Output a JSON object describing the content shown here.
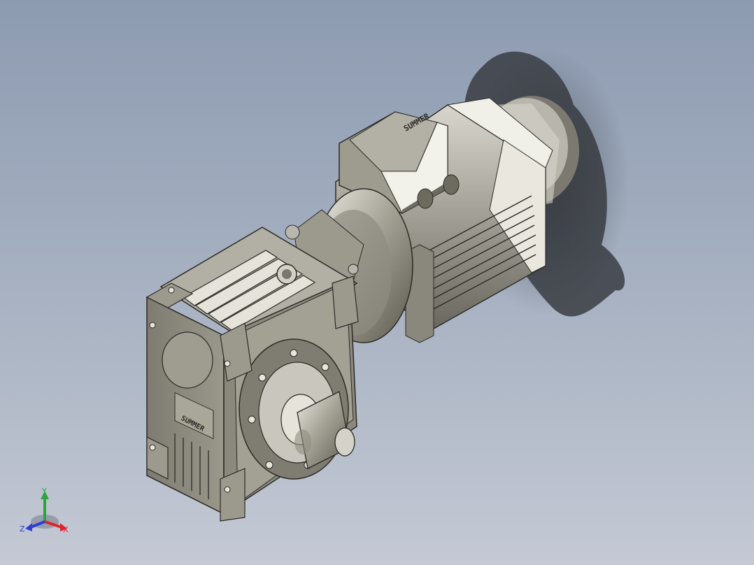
{
  "viewport": {
    "background_top": "#8d9bb1",
    "background_bottom": "#c4c9d4"
  },
  "model": {
    "type": "worm gearmotor",
    "nameplate_text": "SUMMER",
    "parts": [
      "electric-motor",
      "terminal-box",
      "motor-flange",
      "worm-gearbox",
      "output-shaft",
      "cooling-fins",
      "fan-cover"
    ],
    "body_color": "#8f8c80",
    "highlight_color": "#e8e6dc",
    "shadow_color": "#3f4248"
  },
  "triad": {
    "x_label": "X",
    "y_label": "Y",
    "z_label": "Z",
    "x_color": "#e0232b",
    "y_color": "#2aa63a",
    "z_color": "#2b3fd6"
  }
}
